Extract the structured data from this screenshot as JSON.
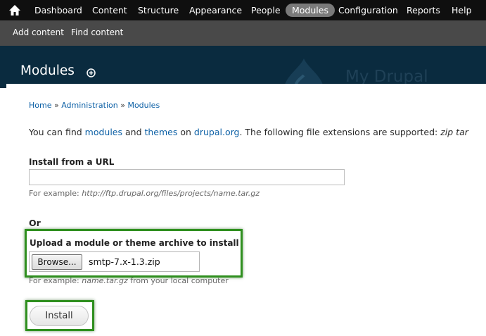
{
  "toolbar": {
    "items": [
      {
        "label": "Dashboard"
      },
      {
        "label": "Content"
      },
      {
        "label": "Structure"
      },
      {
        "label": "Appearance"
      },
      {
        "label": "People"
      },
      {
        "label": "Modules",
        "active": true
      },
      {
        "label": "Configuration"
      },
      {
        "label": "Reports"
      },
      {
        "label": "Help"
      }
    ]
  },
  "shortcuts": {
    "items": [
      {
        "label": "Add content"
      },
      {
        "label": "Find content"
      }
    ]
  },
  "header": {
    "title": "Modules",
    "site_name": "My Drupal"
  },
  "breadcrumb": {
    "items": [
      "Home",
      "Administration",
      "Modules"
    ],
    "separator": "»"
  },
  "help": {
    "t1": "You can find ",
    "link_modules": "modules",
    "t2": " and ",
    "link_themes": "themes",
    "t3": " on ",
    "link_drupal": "drupal.org",
    "t4": ". The following file extensions are supported: ",
    "extensions": "zip tar"
  },
  "install_url": {
    "label": "Install from a URL",
    "value": "",
    "desc_prefix": "For example: ",
    "desc_example": "http://ftp.drupal.org/files/projects/name.tar.gz"
  },
  "or_label": "Or",
  "upload": {
    "label": "Upload a module or theme archive to install",
    "browse_label": "Browse...",
    "file_name": "smtp-7.x-1.3.zip",
    "desc_prefix": "For example: ",
    "desc_example": "name.tar.gz",
    "desc_suffix": " from your local computer"
  },
  "actions": {
    "install_label": "Install"
  },
  "colors": {
    "toolbar_bg": "#0f0f0f",
    "shortcuts_bg": "#494949",
    "header_bg": "#0a2b3f",
    "link": "#0b5fa5",
    "highlight": "#2f8f1f"
  }
}
